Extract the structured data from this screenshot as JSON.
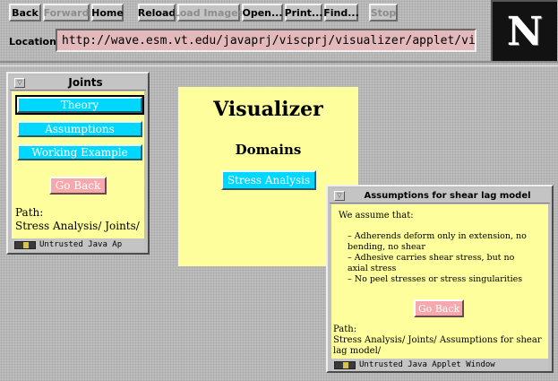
{
  "browser": {
    "toolbar": {
      "back": "Back",
      "forward": "Forward",
      "home": "Home",
      "reload": "Reload",
      "load_images": "Load Images",
      "open": "Open...",
      "print": "Print...",
      "find": "Find...",
      "stop": "Stop"
    },
    "location_label": "Location:",
    "location_url": "http://wave.esm.vt.edu/javaprj/viscprj/visualizer/applet/visualiz",
    "logo_letter": "N"
  },
  "main_panel": {
    "title": "Visualizer",
    "subtitle": "Domains",
    "button": "Stress Analysis"
  },
  "joints_window": {
    "title": "Joints",
    "buttons": [
      "Theory",
      "Assumptions",
      "Working Example"
    ],
    "go_back": "Go Back",
    "path_label": "Path:",
    "path_value": "Stress Analysis/ Joints/",
    "status": "Untrusted Java Ap"
  },
  "assumptions_window": {
    "title": "Assumptions for shear lag model",
    "intro": "We assume that:",
    "items": [
      "–  Adherends deform only in extension, no bending, no shear",
      "–  Adhesive carries shear stress, but no axial stress",
      "–  No peel stresses or stress singularities"
    ],
    "go_back": "Go Back",
    "path_label": "Path:",
    "path_value": "Stress Analysis/ Joints/ Assumptions for shear lag model/",
    "status": "Untrusted Java Applet Window"
  },
  "colors": {
    "panel_yellow": "#fefe9c",
    "button_cyan": "#00d7ff",
    "button_pink": "#f6a8ad",
    "location_pink": "#e3b9bc"
  }
}
